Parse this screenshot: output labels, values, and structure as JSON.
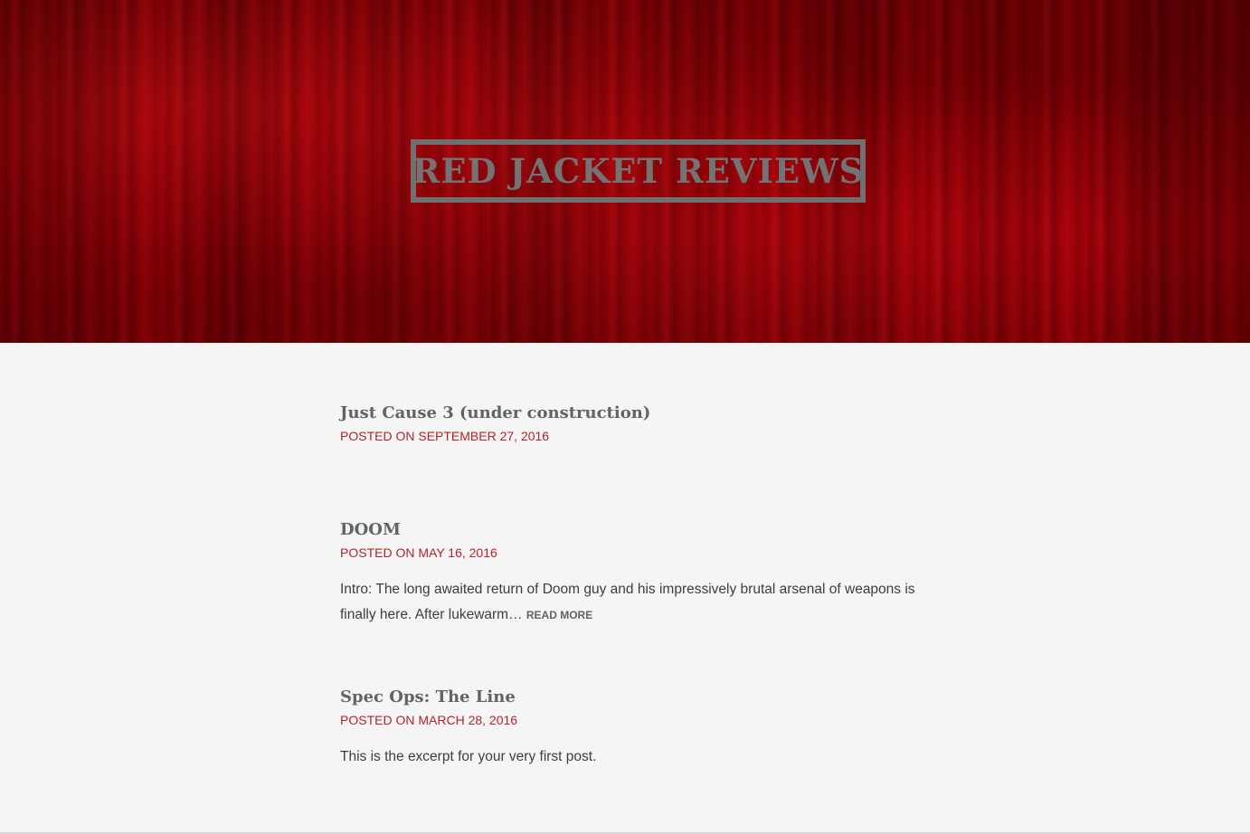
{
  "site": {
    "title": "RED JACKET REVIEWS"
  },
  "posts": [
    {
      "title": "Just Cause 3 (under construction)",
      "posted_on": "Posted on",
      "date": "September 27, 2016",
      "excerpt": "",
      "read_more": ""
    },
    {
      "title": "DOOM",
      "posted_on": "Posted on",
      "date": "May 16, 2016",
      "excerpt": "Intro: The long awaited return of Doom guy and his impressively brutal arsenal of weapons is finally here. After lukewarm…",
      "read_more": "Read More"
    },
    {
      "title": "Spec Ops: The Line",
      "posted_on": "Posted on",
      "date": "March 28, 2016",
      "excerpt": "This is the excerpt for your very first post.",
      "read_more": ""
    }
  ],
  "colors": {
    "accent": "#b5232b",
    "title_gray": "#737373",
    "hero_red": "#9c0006",
    "background": "#f5f5f5"
  }
}
